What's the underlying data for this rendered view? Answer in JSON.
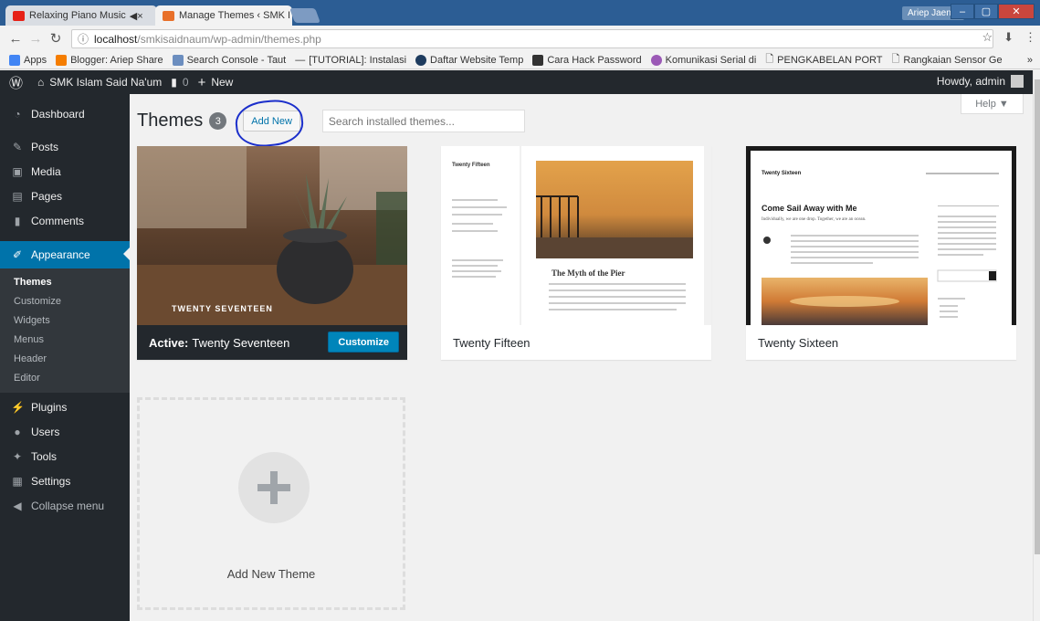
{
  "browser": {
    "tabs": [
      {
        "label": "Relaxing Piano Music",
        "audio": "◀×",
        "active": false
      },
      {
        "label": "Manage Themes ‹ SMK I",
        "active": true
      }
    ],
    "user": "Ariep Jaenul",
    "url_host": "localhost",
    "url_path": "/smkisaidnaum/wp-admin/themes.php",
    "bookmarks": [
      "Apps",
      "Blogger: Ariep Share",
      "Search Console - Taut",
      "[TUTORIAL]: Instalasi",
      "Daftar Website Temp",
      "Cara Hack Password",
      "Komunikasi Serial di",
      "PENGKABELAN PORT",
      "Rangkaian Sensor Ge"
    ],
    "more": "»"
  },
  "adminbar": {
    "site": "SMK Islam Said Na'um",
    "comments": "0",
    "new": "New",
    "howdy": "Howdy, admin"
  },
  "menu": {
    "dashboard": "Dashboard",
    "posts": "Posts",
    "media": "Media",
    "pages": "Pages",
    "comments": "Comments",
    "appearance": "Appearance",
    "sub": [
      "Themes",
      "Customize",
      "Widgets",
      "Menus",
      "Header",
      "Editor"
    ],
    "plugins": "Plugins",
    "users": "Users",
    "tools": "Tools",
    "settings": "Settings",
    "collapse": "Collapse menu"
  },
  "page": {
    "title": "Themes",
    "count": "3",
    "add_new": "Add New",
    "search_placeholder": "Search installed themes...",
    "help": "Help ▼"
  },
  "themes": {
    "active_prefix": "Active:",
    "active_name": "Twenty Seventeen",
    "customize": "Customize",
    "second": "Twenty Fifteen",
    "third": "Twenty Sixteen",
    "add_new_theme": "Add New Theme",
    "shot1_caption": "TWENTY SEVENTEEN",
    "shot2_heading": "The Myth of the Pier",
    "shot2_site": "Twenty Fifteen",
    "shot3_site": "Twenty Sixteen",
    "shot3_heading": "Come Sail Away with Me",
    "shot3_sub": "Individually, we are one drop. Together, we are an ocean."
  }
}
